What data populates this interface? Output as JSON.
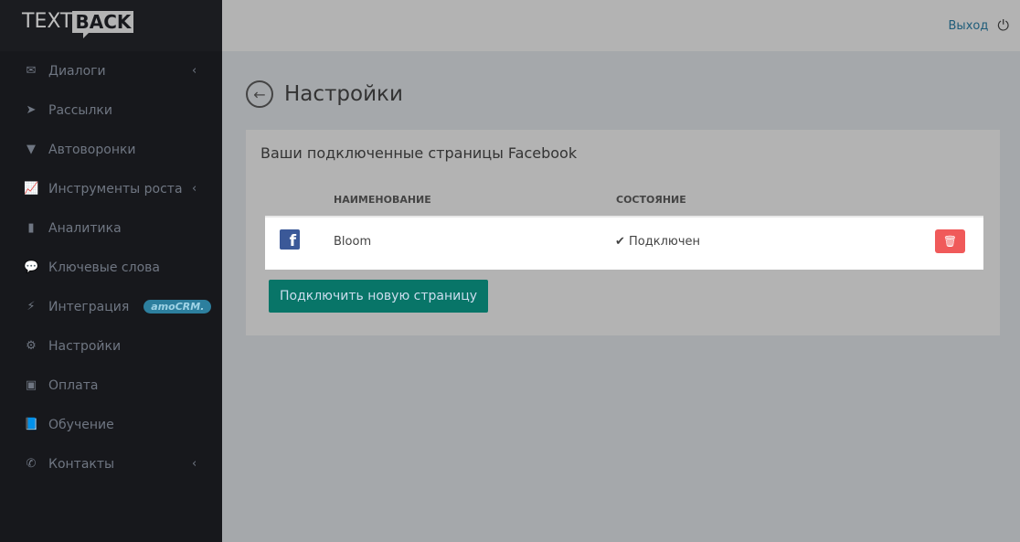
{
  "logo": {
    "text": "TEXT",
    "bold": "BACK"
  },
  "sidebar": {
    "items": [
      {
        "label": "Диалоги",
        "icon": "✉",
        "chev": "‹"
      },
      {
        "label": "Рассылки",
        "icon": "➤",
        "chev": ""
      },
      {
        "label": "Автоворонки",
        "icon": "▼",
        "chev": ""
      },
      {
        "label": "Инструменты роста",
        "icon": "📈",
        "chev": "‹"
      },
      {
        "label": "Аналитика",
        "icon": "▮",
        "chev": ""
      },
      {
        "label": "Ключевые слова",
        "icon": "💬",
        "chev": ""
      },
      {
        "label": "Интеграция",
        "icon": "⚡",
        "chev": "",
        "badge": "amoCRM."
      },
      {
        "label": "Настройки",
        "icon": "⚙",
        "chev": ""
      },
      {
        "label": "Оплата",
        "icon": "▣",
        "chev": ""
      },
      {
        "label": "Обучение",
        "icon": "📘",
        "chev": ""
      },
      {
        "label": "Контакты",
        "icon": "✆",
        "chev": "‹"
      }
    ]
  },
  "header": {
    "logout": "Выход"
  },
  "page": {
    "title": "Настройки"
  },
  "panel": {
    "heading": "Ваши подключенные страницы Facebook",
    "col_name": "НАИМЕНОВАНИЕ",
    "col_status": "СОСТОЯНИЕ",
    "rows": [
      {
        "name": "Bloom",
        "status": "Подключен"
      }
    ],
    "add_button": "Подключить новую страницу"
  }
}
